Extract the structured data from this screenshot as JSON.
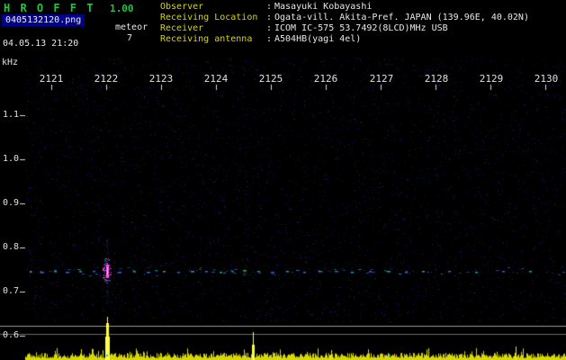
{
  "header": {
    "app_name": "H R O F F T",
    "version": "1.00",
    "filename": "0405132120.png",
    "mode": "meteor",
    "count": "7",
    "datetime": "04.05.13 21:20",
    "separator": ":",
    "info": [
      {
        "label": "Observer",
        "value": "Masayuki Kobayashi"
      },
      {
        "label": "Receiving Location",
        "value": "Ogata-vill. Akita-Pref. JAPAN (139.96E, 40.02N)"
      },
      {
        "label": "Receiver",
        "value": "ICOM IC-575 53.7492(8LCD)MHz USB"
      },
      {
        "label": "Receiving antenna",
        "value": "A504HB(yagi 4el)"
      }
    ],
    "colors": {
      "title": "#22c53e",
      "label": "#d8d800",
      "value": "#e8e8e8",
      "filename_bg": "#000088"
    }
  },
  "chart_data": {
    "type": "heatmap",
    "title": "HROFFT radio meteor echo spectrogram 21:20-21:30",
    "x_axis": {
      "unit": "time HHMM",
      "labels": [
        "2121",
        "2122",
        "2123",
        "2124",
        "2125",
        "2126",
        "2127",
        "2128",
        "2129",
        "2130"
      ]
    },
    "y_axis": {
      "label": "kHz",
      "ticks": [
        "1.1",
        "1.0",
        "0.9",
        "0.8",
        "0.7",
        "0.6"
      ],
      "range": [
        0.55,
        1.2
      ]
    },
    "carrier_band": {
      "f_khz": 0.745,
      "t_start": 2120.55,
      "t_end": 2130.3
    },
    "events": [
      {
        "t": 2120.61,
        "f": 0.745,
        "kind": "dot",
        "len": 2,
        "color": "#cc44cc"
      },
      {
        "t": 2120.85,
        "f": 0.744,
        "kind": "dash",
        "len": 4,
        "color": "#3a6cff"
      },
      {
        "t": 2121.08,
        "f": 0.746,
        "kind": "dash",
        "len": 3,
        "color": "#00c0c0"
      },
      {
        "t": 2121.31,
        "f": 0.744,
        "kind": "dash",
        "len": 4,
        "color": "#3a6cff"
      },
      {
        "t": 2121.54,
        "f": 0.746,
        "kind": "dash",
        "len": 3,
        "color": "#00c0c0"
      },
      {
        "t": 2121.77,
        "f": 0.745,
        "kind": "dash",
        "len": 3,
        "color": "#3a6cff"
      },
      {
        "t": 2122.03,
        "f": 0.745,
        "kind": "meteor",
        "len": 5,
        "color": "#ff55dd"
      },
      {
        "t": 2122.26,
        "f": 0.744,
        "kind": "dash",
        "len": 4,
        "color": "#3a6cff"
      },
      {
        "t": 2122.52,
        "f": 0.746,
        "kind": "dash",
        "len": 3,
        "color": "#00c0c0"
      },
      {
        "t": 2122.78,
        "f": 0.744,
        "kind": "dash",
        "len": 4,
        "color": "#3a6cff"
      },
      {
        "t": 2123.05,
        "f": 0.746,
        "kind": "dash",
        "len": 3,
        "color": "#00c0c0"
      },
      {
        "t": 2123.31,
        "f": 0.744,
        "kind": "dash",
        "len": 3,
        "color": "#3a6cff"
      },
      {
        "t": 2123.57,
        "f": 0.746,
        "kind": "dash",
        "len": 4,
        "color": "#00c0c0"
      },
      {
        "t": 2123.83,
        "f": 0.745,
        "kind": "dash",
        "len": 3,
        "color": "#3a6cff"
      },
      {
        "t": 2124.09,
        "f": 0.744,
        "kind": "dash",
        "len": 3,
        "color": "#00c0c0"
      },
      {
        "t": 2124.29,
        "f": 0.746,
        "kind": "dash",
        "len": 3,
        "color": "#3a6cff"
      },
      {
        "t": 2124.52,
        "f": 0.747,
        "kind": "dash",
        "len": 4,
        "color": "#33cc66"
      },
      {
        "t": 2124.78,
        "f": 0.745,
        "kind": "dash",
        "len": 3,
        "color": "#00c0c0"
      },
      {
        "t": 2125.04,
        "f": 0.744,
        "kind": "dash",
        "len": 4,
        "color": "#3a6cff"
      },
      {
        "t": 2125.3,
        "f": 0.746,
        "kind": "dash",
        "len": 3,
        "color": "#00c0c0"
      },
      {
        "t": 2125.6,
        "f": 0.744,
        "kind": "dash",
        "len": 3,
        "color": "#3a6cff"
      },
      {
        "t": 2125.89,
        "f": 0.746,
        "kind": "dash",
        "len": 3,
        "color": "#00c0c0"
      },
      {
        "t": 2126.19,
        "f": 0.745,
        "kind": "dash",
        "len": 4,
        "color": "#3a6cff"
      },
      {
        "t": 2126.48,
        "f": 0.744,
        "kind": "dash",
        "len": 3,
        "color": "#00c0c0"
      },
      {
        "t": 2126.81,
        "f": 0.746,
        "kind": "dash",
        "len": 3,
        "color": "#3a6cff"
      },
      {
        "t": 2127.14,
        "f": 0.745,
        "kind": "dash",
        "len": 4,
        "color": "#00c0c0"
      },
      {
        "t": 2127.46,
        "f": 0.744,
        "kind": "dash",
        "len": 3,
        "color": "#3a6cff"
      },
      {
        "t": 2127.76,
        "f": 0.746,
        "kind": "dash",
        "len": 3,
        "color": "#00c0c0"
      },
      {
        "t": 2128.25,
        "f": 0.745,
        "kind": "dash",
        "len": 3,
        "color": "#3a6cff"
      },
      {
        "t": 2128.74,
        "f": 0.744,
        "kind": "dash",
        "len": 3,
        "color": "#00c0c0"
      },
      {
        "t": 2129.23,
        "f": 0.746,
        "kind": "dash",
        "len": 3,
        "color": "#3a6cff"
      },
      {
        "t": 2129.72,
        "f": 0.745,
        "kind": "dash",
        "len": 3,
        "color": "#00c0c0"
      }
    ],
    "amplitude_spikes": [
      {
        "t": 2122.03,
        "h": 48,
        "w": 5,
        "color": "#ffff44"
      },
      {
        "t": 2124.67,
        "h": 31,
        "w": 3,
        "color": "#ffff44"
      },
      {
        "t": 2129.45,
        "h": 15,
        "w": 2,
        "color": "#e8e800"
      },
      {
        "t": 2121.55,
        "h": 12,
        "w": 2,
        "color": "#e8e800"
      },
      {
        "t": 2126.1,
        "h": 11,
        "w": 2,
        "color": "#e8e800"
      }
    ],
    "bottom_marks": [
      {
        "t": 2122.0,
        "color": "#00cccc"
      },
      {
        "t": 2127.15,
        "color": "#00cccc"
      }
    ],
    "colors": {
      "background": "#000000",
      "noise": [
        "#10104a",
        "#181890",
        "#2020b0",
        "#262ca0",
        "#0c0c60",
        "#123060"
      ],
      "band": [
        "#3a6cff",
        "#00c0c0",
        "#5588ff"
      ],
      "amplitude": "#d8d800",
      "amplitude_bright": "#ffff44",
      "ref_line_light": "#9a9a9a",
      "ref_line_dark": "#6a6a6a",
      "tick": "#d8d8d8",
      "meteor_core": "#ff55dd",
      "meteor_halo": [
        "#e040c0",
        "#b030d0",
        "#4a6cff",
        "#00c0c0",
        "#ff55dd"
      ]
    }
  }
}
